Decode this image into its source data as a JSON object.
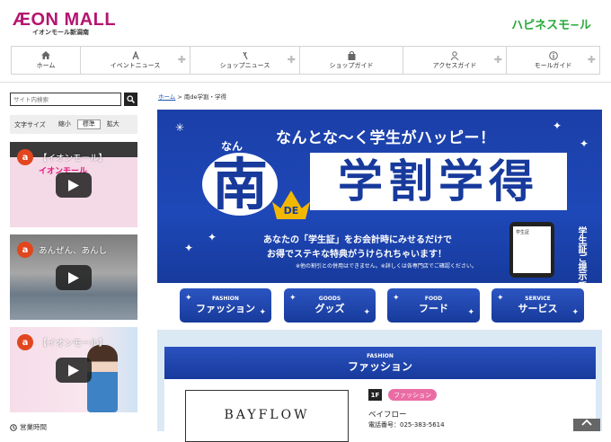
{
  "header": {
    "logo": "ÆON MALL",
    "logo_sub": "イオンモール新潟南",
    "brand_right": "ハピネスモ−ル"
  },
  "gnav": [
    {
      "icon": "home-icon",
      "label": "ホーム"
    },
    {
      "icon": "event-icon",
      "label": "イベントニュース"
    },
    {
      "icon": "shop-news-icon",
      "label": "ショップニュース"
    },
    {
      "icon": "bag-icon",
      "label": "ショップガイド"
    },
    {
      "icon": "person-icon",
      "label": "アクセスガイド"
    },
    {
      "icon": "info-icon",
      "label": "モールガイド"
    }
  ],
  "sidebar": {
    "search_placeholder": "サイト内検索",
    "fontsize_label": "文字サイズ",
    "fontsize_options": [
      "縮小",
      "標準",
      "拡大"
    ],
    "videos": [
      {
        "avatar": "a",
        "title": "【イオンモール】",
        "subtitle": "イオンモール"
      },
      {
        "avatar": "a",
        "title": "あんぜん、あんし",
        "subtitle": ""
      },
      {
        "avatar": "a",
        "title": "【イオンモール】",
        "subtitle": ""
      }
    ],
    "hours_label": "営業時間"
  },
  "breadcrumb": {
    "home": "ホーム",
    "separator": ">",
    "current": "南de学割・学得"
  },
  "hero": {
    "top_text": "なんとな〜く学生がハッピー！",
    "nan_reading": "なん",
    "kanji": "南",
    "de": "DE",
    "banner": "学割学得",
    "message_line1": "あなたの「学生証」をお会計時にみせるだけで",
    "message_line2": "お得でステキな特典がうけられちゃいます！",
    "note": "※他の割引との併用はできません。※詳しくは各専門店でご確認ください。",
    "vertical_text": "学生証ご提示で!!",
    "phone_text": "学生証"
  },
  "categories": [
    {
      "en": "FASHION",
      "jp": "ファッション"
    },
    {
      "en": "GOODS",
      "jp": "グッズ"
    },
    {
      "en": "FOOD",
      "jp": "フード"
    },
    {
      "en": "SERVICE",
      "jp": "サービス"
    }
  ],
  "section": {
    "en": "FASHION",
    "jp": "ファッション",
    "shop": {
      "logo_text": "BAYFLOW",
      "floor": "1F",
      "tag": "ファッション",
      "name": "ベイフロー",
      "tel": "電話番号：025-383-5614"
    }
  },
  "colors": {
    "brand_magenta": "#b5156f",
    "happiness_green": "#2aa93a",
    "hero_blue": "#1e48b8",
    "tag_pink": "#ea6ca4",
    "section_bg": "#dbe9f5"
  }
}
